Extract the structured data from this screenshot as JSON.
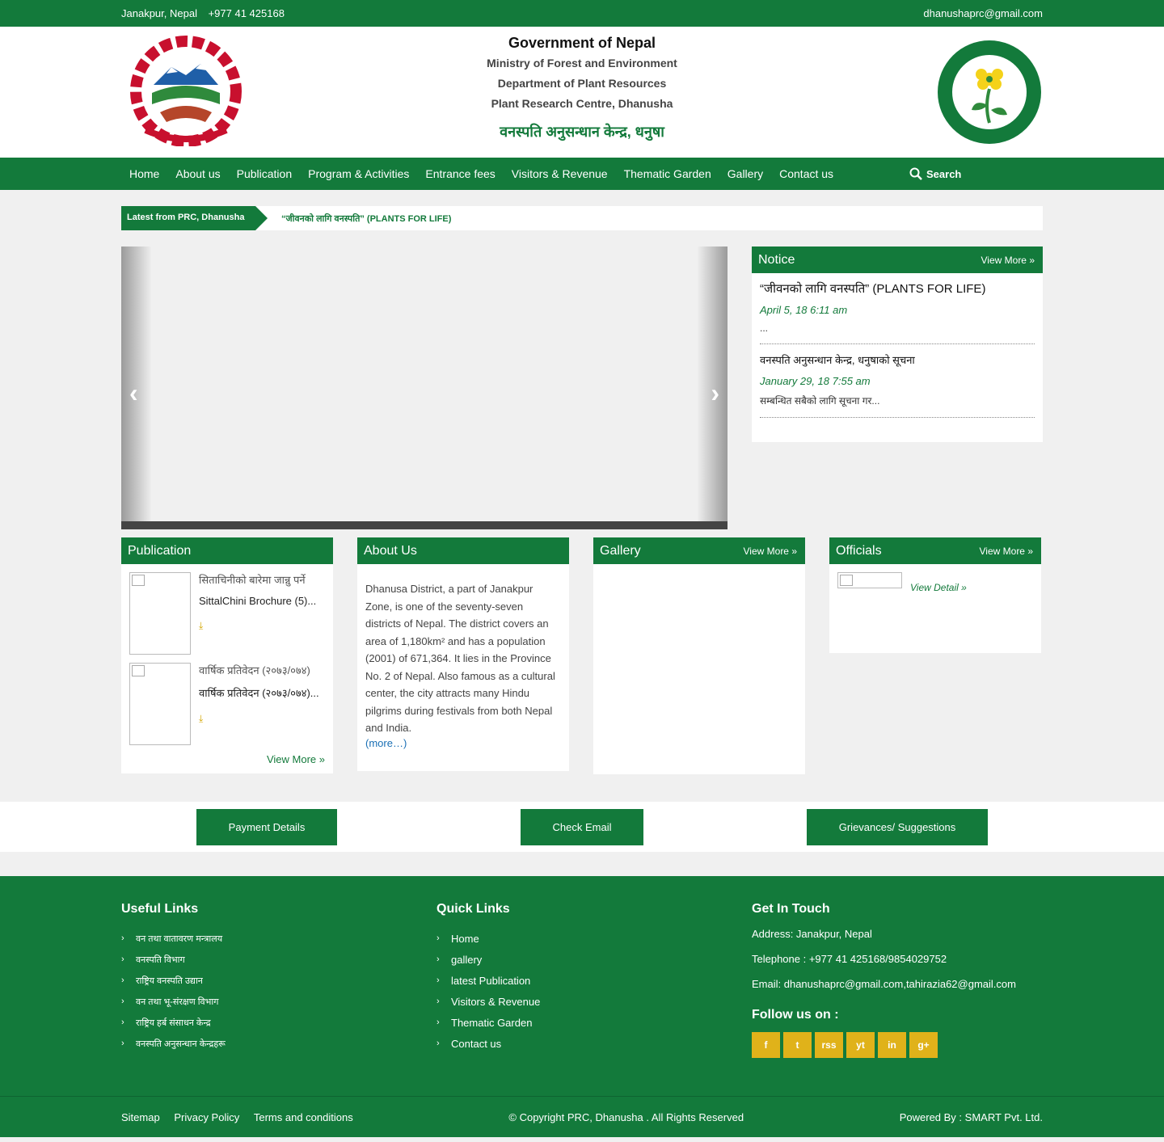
{
  "topbar": {
    "location": "Janakpur, Nepal",
    "phone": "+977 41 425168",
    "email": "dhanushaprc@gmail.com"
  },
  "header": {
    "gov": "Government of Nepal",
    "ministry": "Ministry of Forest and Environment",
    "department": "Department of Plant Resources",
    "centre": "Plant Research Centre, Dhanusha",
    "nepali_title": "वनस्पति अनुसन्धान केन्द्र, धनुषा",
    "logo_right_text": "जीवनको लागि वनस्पति",
    "logo_right_sub": "PLANTS FOR LIFE"
  },
  "nav": {
    "items": [
      "Home",
      "About us",
      "Publication",
      "Program & Activities",
      "Entrance fees",
      "Visitors & Revenue",
      "Thematic Garden",
      "Gallery",
      "Contact us"
    ],
    "search": "Search"
  },
  "ticker": {
    "label": "Latest from PRC, Dhanusha",
    "news": "“जीवनको लागि वनस्पति” (PLANTS FOR LIFE)"
  },
  "slider": {
    "prev": "‹",
    "next": "›"
  },
  "notice": {
    "title": "Notice",
    "more": "View More »",
    "items": [
      {
        "title": "“जीवनको लागि वनस्पति” (PLANTS FOR LIFE)",
        "date": "April 5, 18 6:11 am",
        "excerpt": "..."
      },
      {
        "title": "वनस्पति अनुसन्धान केन्द्र, धनुषाको सूचना",
        "date": "January 29, 18 7:55 am",
        "excerpt": "सम्बन्धित सबैको लागि सूचना गर..."
      }
    ]
  },
  "publication": {
    "title": "Publication",
    "items": [
      {
        "title": "सिताचिनीको बारेमा जान्नु पर्ने",
        "desc": "SittalChini Brochure (5)..."
      },
      {
        "title": "वार्षिक प्रतिवेदन (२०७३/०७४)",
        "desc": "वार्षिक प्रतिवेदन (२०७३/०७४)..."
      }
    ],
    "more": "View More »"
  },
  "about": {
    "title": "About Us",
    "text": "Dhanusa District, a part of Janakpur Zone, is one of the seventy-seven districts of Nepal. The district covers an area of 1,180km² and has a population (2001) of 671,364. It lies in the Province No. 2 of Nepal. Also famous as a cultural center, the city attracts many Hindu pilgrims during festivals from both Nepal and India.",
    "more": "(more…)"
  },
  "gallery": {
    "title": "Gallery",
    "more": "View More »"
  },
  "officials": {
    "title": "Officials",
    "more": "View More »",
    "detail": "View Detail »"
  },
  "buttons": {
    "payment": "Payment Details",
    "email": "Check Email",
    "grievance": "Grievances/ Suggestions"
  },
  "footer": {
    "useful_title": "Useful Links",
    "useful": [
      "वन तथा वातावरण मन्त्रालय",
      "वनस्पति विभाग",
      "राष्ट्रिय वनस्पति उद्यान",
      "वन तथा भू-संरक्षण विभाग",
      "राष्ट्रिय हर्ब संसाधन केन्द्र",
      "वनस्पति अनुसन्धान केन्द्रहरू"
    ],
    "quick_title": "Quick Links",
    "quick": [
      "Home",
      "gallery",
      "latest Publication",
      "Visitors & Revenue",
      "Thematic Garden",
      "Contact us"
    ],
    "touch_title": "Get In Touch",
    "address": "Address: Janakpur, Nepal",
    "telephone": "Telephone : +977 41 425168/9854029752",
    "email": "Email: dhanushaprc@gmail.com,tahirazia62@gmail.com",
    "follow": "Follow us on :",
    "social": [
      "f",
      "t",
      "rss",
      "yt",
      "in",
      "g+"
    ]
  },
  "bottom": {
    "links": [
      "Sitemap",
      "Privacy Policy",
      "Terms and conditions"
    ],
    "copyright": "© Copyright PRC, Dhanusha . All Rights Reserved",
    "powered": "Powered By : SMART Pvt. Ltd."
  },
  "colors": {
    "primary": "#137a3b",
    "accent": "#e0b21a"
  }
}
